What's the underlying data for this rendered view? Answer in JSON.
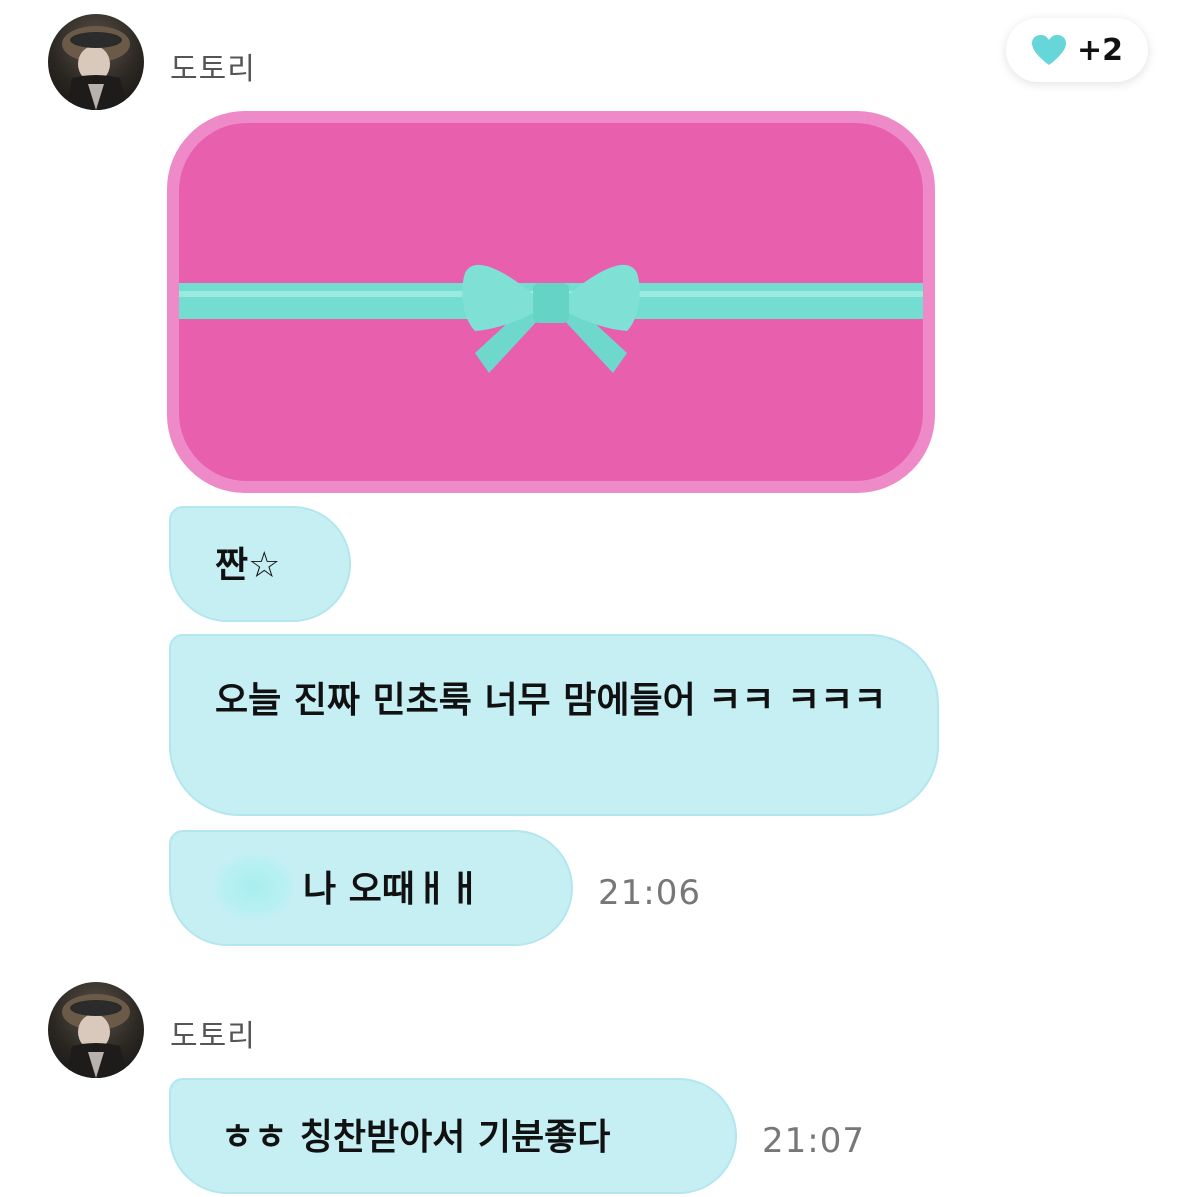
{
  "reaction": {
    "icon": "heart-icon",
    "color": "#67d6d9",
    "count": "+2"
  },
  "messages": [
    {
      "sender": "도토리",
      "gift": {
        "box_color": "#e85fae",
        "ribbon_color": "#74ddd2"
      },
      "bubbles": [
        {
          "text": "짠☆"
        },
        {
          "text": "오늘 진짜 민초룩 너무 맘에들어 ㅋㅋ ㅋㅋㅋ"
        },
        {
          "text": "나 오때ㅐㅐ",
          "time": "21:06"
        }
      ]
    },
    {
      "sender": "도토리",
      "bubbles": [
        {
          "text": "ㅎㅎ 칭찬받아서 기분좋다",
          "time": "21:07"
        }
      ]
    }
  ],
  "colors": {
    "bubble": "#c6eff4",
    "timestamp": "#777777",
    "name": "#555555"
  }
}
